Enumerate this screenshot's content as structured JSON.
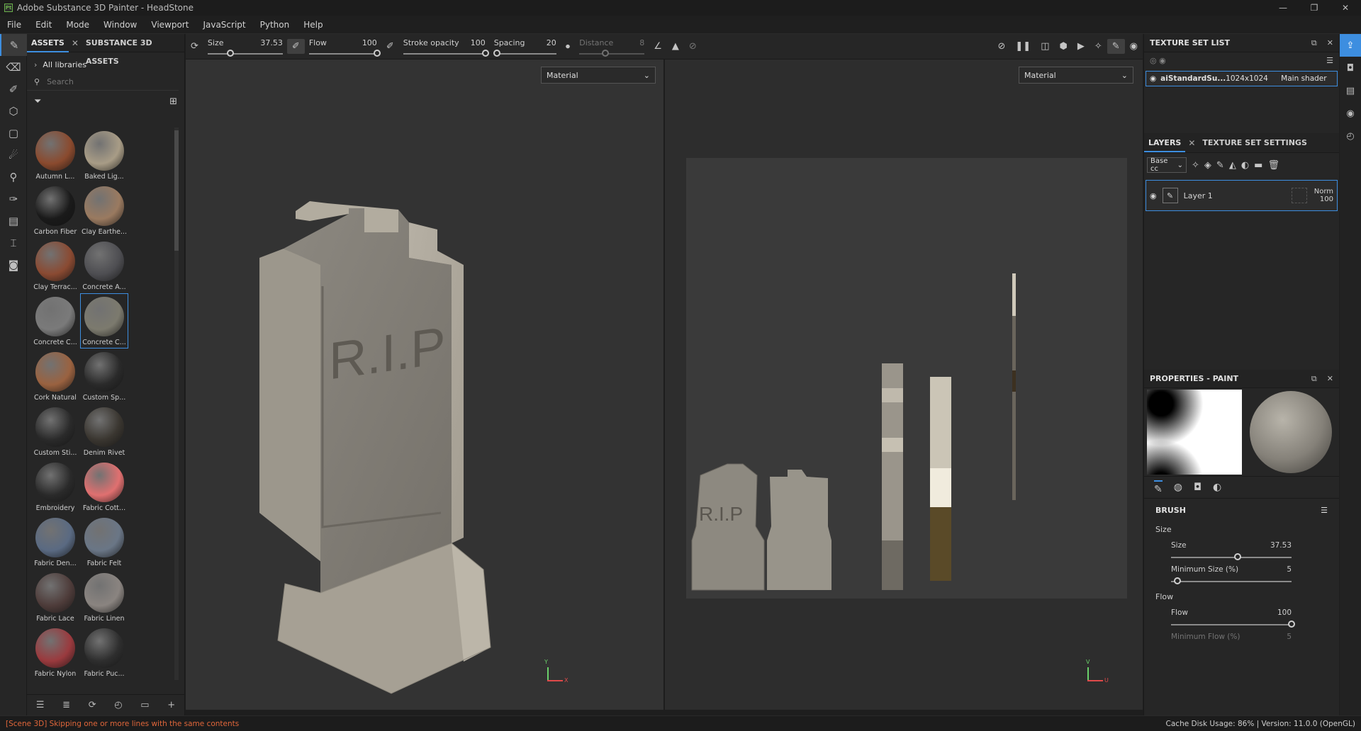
{
  "window": {
    "title": "Adobe Substance 3D Painter - HeadStone",
    "logo_text": "Pt",
    "controls": [
      "—",
      "❐",
      "✕"
    ]
  },
  "menu": [
    "File",
    "Edit",
    "Mode",
    "Window",
    "Viewport",
    "JavaScript",
    "Python",
    "Help"
  ],
  "assets_panel": {
    "tabs": [
      "ASSETS",
      "SUBSTANCE 3D ASSETS"
    ],
    "library": "All libraries",
    "search_placeholder": "Search",
    "items": [
      {
        "name": "Autumn L...",
        "color": "#8a4a2e"
      },
      {
        "name": "Baked Lig...",
        "color": "#a89c86"
      },
      {
        "name": "Carbon Fiber",
        "color": "#1a1a1a"
      },
      {
        "name": "Clay Earthe...",
        "color": "#9a7a60"
      },
      {
        "name": "Clay Terrac...",
        "color": "#8a4a32"
      },
      {
        "name": "Concrete A...",
        "color": "#4e4e52"
      },
      {
        "name": "Concrete C...",
        "color": "#7a7a7a"
      },
      {
        "name": "Concrete C...",
        "color": "#7c7a6e"
      },
      {
        "name": "Cork Natural",
        "color": "#9a6240"
      },
      {
        "name": "Custom Sp...",
        "color": "#2a2a2a"
      },
      {
        "name": "Custom Sti...",
        "color": "#2a2a2a"
      },
      {
        "name": "Denim Rivet",
        "color": "#3a3630"
      },
      {
        "name": "Embroidery",
        "color": "#2a2a2a"
      },
      {
        "name": "Fabric Cott...",
        "color": "#e07070"
      },
      {
        "name": "Fabric Den...",
        "color": "#5a6a82"
      },
      {
        "name": "Fabric Felt",
        "color": "#6a7686"
      },
      {
        "name": "Fabric Lace",
        "color": "#4e3c3a"
      },
      {
        "name": "Fabric Linen",
        "color": "#8a8480"
      },
      {
        "name": "Fabric Nylon",
        "color": "#9a3a3e"
      },
      {
        "name": "Fabric Puc...",
        "color": "#2e2e2e"
      }
    ]
  },
  "toolbar": {
    "size_label": "Size",
    "size_value": "37.53",
    "size_fraction": 0.3,
    "flow_label": "Flow",
    "flow_value": "100",
    "flow_fraction": 1.0,
    "opacity_label": "Stroke opacity",
    "opacity_value": "100",
    "opacity_fraction": 1.0,
    "spacing_label": "Spacing",
    "spacing_value": "20",
    "spacing_fraction": 0.05,
    "distance_label": "Distance",
    "distance_value": "8",
    "distance_fraction": 0.4
  },
  "viewports": {
    "left_mode": "Material",
    "right_mode": "Material",
    "engraving": "R.I.P",
    "uv_engraving": "R.I.P"
  },
  "texture_set": {
    "title": "TEXTURE SET LIST",
    "name": "aiStandardSu...",
    "resolution": "1024x1024",
    "shader": "Main shader"
  },
  "layers": {
    "tabs": [
      "LAYERS",
      "TEXTURE SET SETTINGS"
    ],
    "channel": "Base cc",
    "items": [
      {
        "name": "Layer 1",
        "blend": "Norm",
        "opacity": "100"
      }
    ]
  },
  "properties": {
    "title": "PROPERTIES - PAINT",
    "section": "BRUSH",
    "size_group": "Size",
    "size_label": "Size",
    "size_value": "37.53",
    "size_fraction": 0.55,
    "min_size_label": "Minimum Size (%)",
    "min_size_value": "5",
    "min_size_fraction": 0.05,
    "flow_group": "Flow",
    "flow_label": "Flow",
    "flow_value": "100",
    "flow_fraction": 1.0,
    "min_flow_label": "Minimum Flow (%)",
    "min_flow_value": "5"
  },
  "status": {
    "message": "[Scene 3D] Skipping one or more lines with the same contents",
    "right": "Cache Disk Usage:    86% | Version: 11.0.0 (OpenGL)"
  },
  "axes": {
    "left": [
      "Y",
      "X"
    ],
    "right": [
      "V",
      "U"
    ]
  }
}
